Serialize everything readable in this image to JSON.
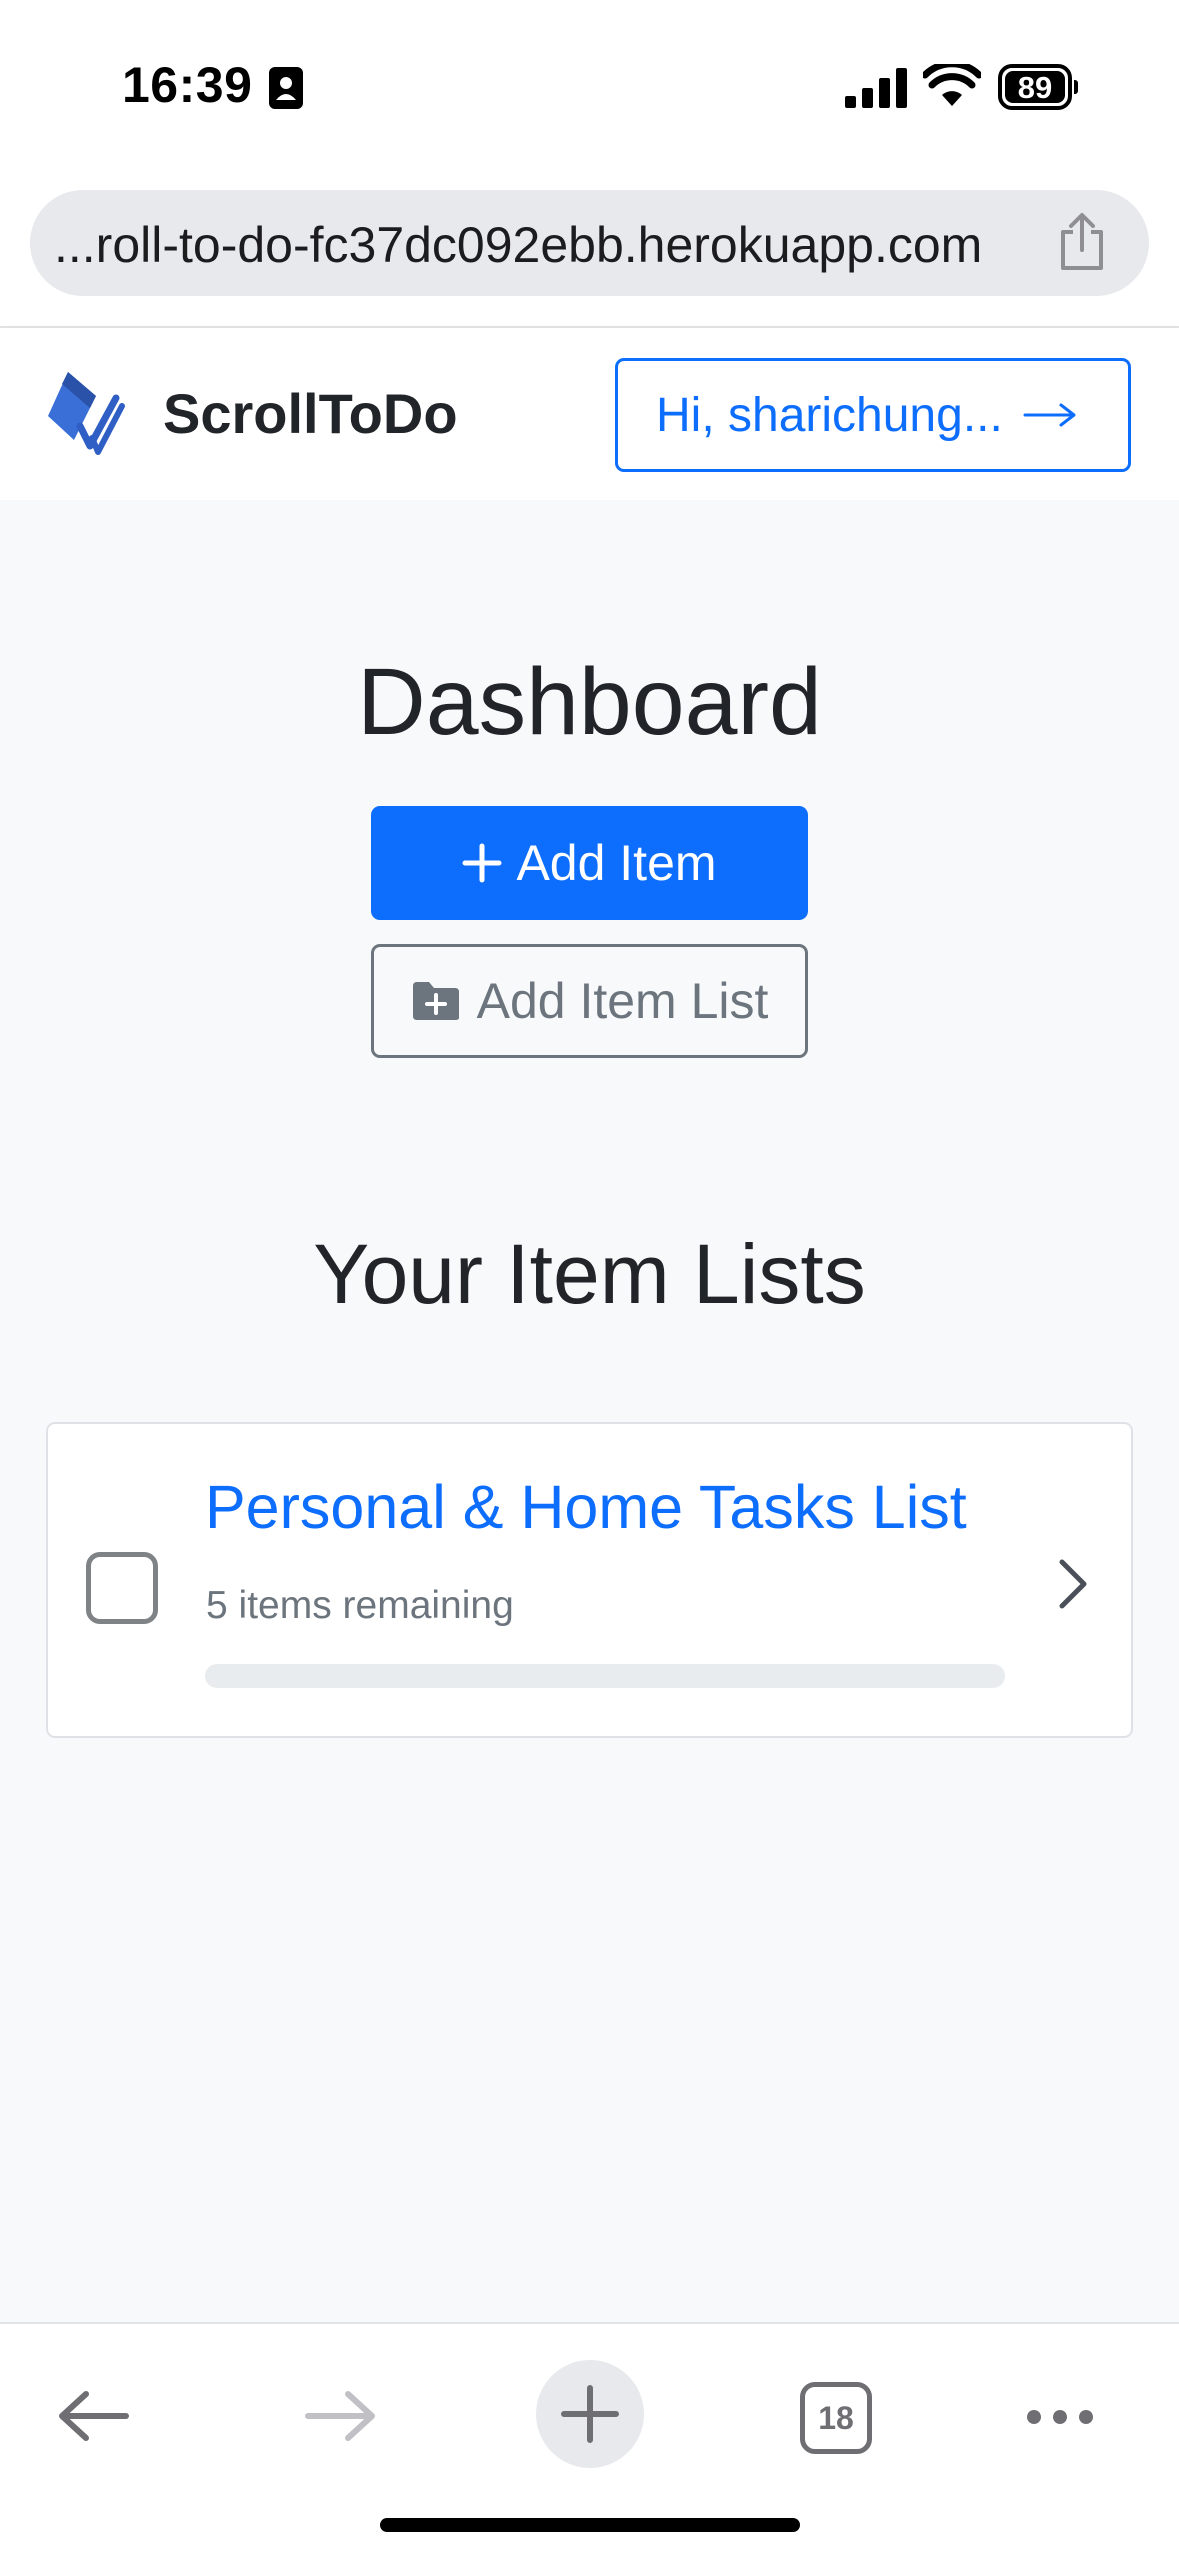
{
  "status_bar": {
    "time": "16:39",
    "battery_level": "89",
    "icons": [
      "id-card-icon",
      "signal-icon",
      "wifi-icon",
      "battery-icon"
    ]
  },
  "browser": {
    "url": "...roll-to-do-fc37dc092ebb.herokuapp.com",
    "icons": [
      "share-icon"
    ],
    "toolbar": {
      "tab_count": "18",
      "icons": [
        "back-arrow-icon",
        "forward-arrow-icon",
        "new-tab-plus-icon",
        "tabs-icon",
        "more-icon"
      ]
    }
  },
  "navbar": {
    "brand": "ScrollToDo",
    "logo_icon": "scrolltodo-logo-icon",
    "user_button": "Hi, sharichung...",
    "user_button_icon": "arrow-right-icon"
  },
  "dashboard": {
    "title": "Dashboard",
    "add_item": "Add Item",
    "add_item_icon": "plus-icon",
    "add_item_list": "Add Item List",
    "add_item_list_icon": "folder-plus-icon",
    "lists_heading": "Your Item Lists",
    "lists": [
      {
        "title": "Personal & Home Tasks List",
        "remaining": "5 items remaining",
        "progress": 0,
        "checked": false
      }
    ]
  },
  "colors": {
    "primary": "#0d6efd",
    "secondary": "#6c757d",
    "page_background": "#f8f9fa",
    "text": "#212529"
  }
}
